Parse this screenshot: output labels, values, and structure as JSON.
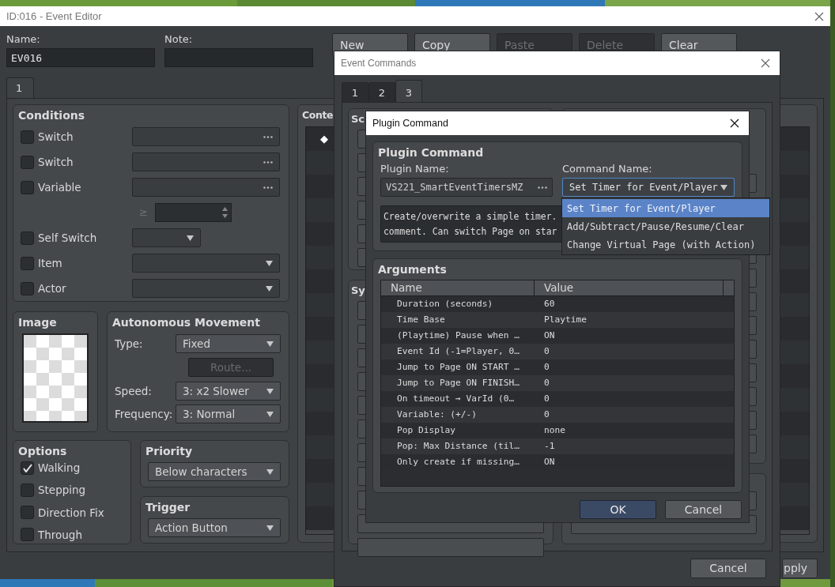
{
  "editor": {
    "title": "ID:016 - Event Editor",
    "name_label": "Name:",
    "name_value": "EV016",
    "note_label": "Note:",
    "page_buttons": [
      {
        "label": "New",
        "disabled": false
      },
      {
        "label": "Copy",
        "disabled": false
      },
      {
        "label": "Paste",
        "disabled": true
      },
      {
        "label": "Delete",
        "disabled": true
      },
      {
        "label": "Clear",
        "disabled": false
      }
    ],
    "page_tabs": [
      {
        "label": "1",
        "selected": true
      }
    ],
    "conditions": {
      "title": "Conditions",
      "rows": [
        {
          "kind": "picker",
          "label": "Switch",
          "checked": false
        },
        {
          "kind": "picker",
          "label": "Switch",
          "checked": false
        },
        {
          "kind": "picker",
          "label": "Variable",
          "checked": false
        },
        {
          "kind": "compare",
          "symbol": "≥"
        },
        {
          "kind": "short-select",
          "label": "Self Switch",
          "checked": false
        },
        {
          "kind": "select",
          "label": "Item",
          "checked": false
        },
        {
          "kind": "select",
          "label": "Actor",
          "checked": false
        }
      ]
    },
    "image": {
      "title": "Image"
    },
    "movement": {
      "title": "Autonomous Movement",
      "type_label": "Type:",
      "type_value": "Fixed",
      "route_button": {
        "label": "Route...",
        "disabled": true
      },
      "speed_label": "Speed:",
      "speed_value": "3: x2 Slower",
      "frequency_label": "Frequency:",
      "frequency_value": "3: Normal"
    },
    "options": {
      "title": "Options",
      "items": [
        {
          "label": "Walking",
          "checked": true
        },
        {
          "label": "Stepping",
          "checked": false
        },
        {
          "label": "Direction Fix",
          "checked": false
        },
        {
          "label": "Through",
          "checked": false
        }
      ]
    },
    "priority": {
      "title": "Priority",
      "value": "Below characters"
    },
    "trigger": {
      "title": "Trigger",
      "value": "Action Button"
    },
    "contents": {
      "title": "Conte",
      "marker": "◆"
    },
    "bottom_buttons": [
      "pply"
    ]
  },
  "event_commands": {
    "title": "Event Commands",
    "tabs": [
      {
        "label": "1",
        "selected": false
      },
      {
        "label": "2",
        "selected": false
      },
      {
        "label": "3",
        "selected": true
      }
    ],
    "group_titles": [
      "Sc",
      "Sy"
    ],
    "cancel": "Cancel"
  },
  "plugin_command": {
    "title": "Plugin Command",
    "group_title": "Plugin Command",
    "plugin_name_label": "Plugin Name:",
    "plugin_name_value": "VS221_SmartEventTimersMZ",
    "command_name_label": "Command Name:",
    "command_value": "Set Timer for Event/Player",
    "dropdown_options": [
      {
        "label": "Set Timer for Event/Player",
        "selected": true
      },
      {
        "label": "Add/Subtract/Pause/Resume/Clear",
        "selected": false
      },
      {
        "label": "Change Virtual Page (with Action)",
        "selected": false
      }
    ],
    "description": [
      "Create/overwrite a simple timer.",
      "comment. Can switch Page on star"
    ],
    "arguments": {
      "title": "Arguments",
      "columns": [
        "Name",
        "Value"
      ],
      "rows": [
        {
          "name": "Duration (seconds)",
          "value": "60"
        },
        {
          "name": "Time Base",
          "value": "Playtime"
        },
        {
          "name": "(Playtime) Pause when …",
          "value": "ON"
        },
        {
          "name": "Event Id (-1=Player, 0…",
          "value": "0"
        },
        {
          "name": "Jump to Page ON START …",
          "value": "0"
        },
        {
          "name": "Jump to Page ON FINISH…",
          "value": "0"
        },
        {
          "name": "On timeout → VarId (0…",
          "value": "0"
        },
        {
          "name": "Variable: (+/-)",
          "value": "0"
        },
        {
          "name": "Pop Display",
          "value": "none"
        },
        {
          "name": "Pop: Max Distance (til…",
          "value": "-1"
        },
        {
          "name": "Only create if missing…",
          "value": "ON"
        }
      ]
    },
    "buttons": [
      {
        "label": "OK",
        "default": true
      },
      {
        "label": "Cancel",
        "default": false
      }
    ]
  }
}
